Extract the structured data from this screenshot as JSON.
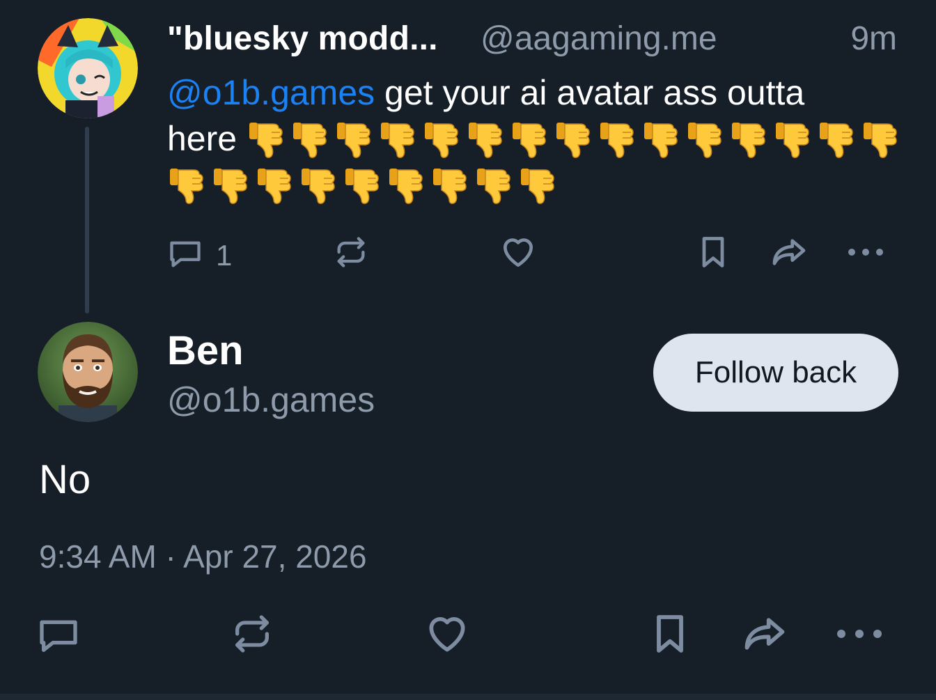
{
  "parent_post": {
    "display_name": "\"bluesky modd...",
    "handle": "@aagaming.me",
    "time_ago": "9m",
    "mention": "@o1b.games",
    "text_line1": " get your ai avatar ass outta",
    "text_line2": "here",
    "emoji_count": 24,
    "reply_count": "1"
  },
  "reply_post": {
    "display_name": "Ben",
    "handle": "@o1b.games",
    "follow_label": "Follow back",
    "text": "No",
    "timestamp": "9:34 AM · Apr 27, 2026"
  },
  "icons": {
    "reply": "reply-icon",
    "repost": "repost-icon",
    "like": "heart-icon",
    "bookmark": "bookmark-icon",
    "share": "share-icon",
    "more": "more-icon",
    "emoji": "thumbs-down-emoji"
  },
  "colors": {
    "background": "#161e27",
    "mention": "#1a82f5",
    "muted": "#8d9bab",
    "icon": "#7d8ca0",
    "button_bg": "#dfe5ee"
  }
}
